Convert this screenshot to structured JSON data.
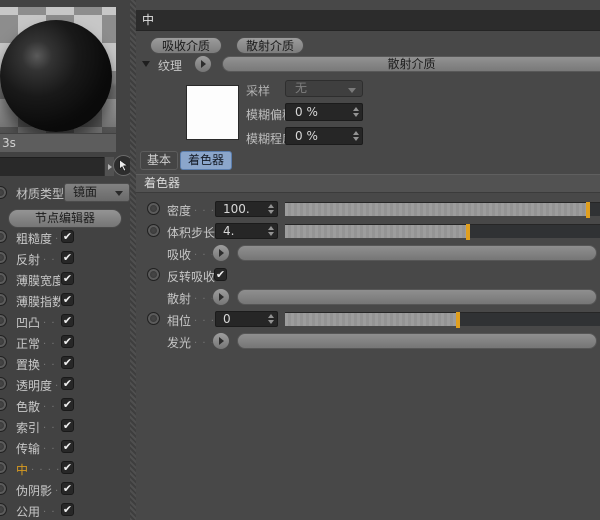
{
  "colors": {
    "accent_orange": "#d89b20",
    "tab_active_blue": "#8ba6cb",
    "slider_handle": "#e09f1e",
    "panel_bg": "#484848"
  },
  "left_panel": {
    "render_time": "3s",
    "name_field_value": "",
    "material_type": {
      "label": "材质类型",
      "value": "镜面"
    },
    "node_editor_button": "节点编辑器",
    "channels": [
      {
        "name": "roughness",
        "label": "粗糙度",
        "dots": ". .",
        "checked": true
      },
      {
        "name": "reflection",
        "label": "反射",
        "dots": ". . .",
        "checked": true
      },
      {
        "name": "film-width",
        "label": "薄膜宽度",
        "dots": "",
        "checked": true
      },
      {
        "name": "film-index",
        "label": "薄膜指数",
        "dots": "",
        "checked": true
      },
      {
        "name": "bump",
        "label": "凹凸",
        "dots": ". . .",
        "checked": true
      },
      {
        "name": "normal",
        "label": "正常",
        "dots": ". . .",
        "checked": true
      },
      {
        "name": "displacement",
        "label": "置换",
        "dots": ". . .",
        "checked": true
      },
      {
        "name": "transparency",
        "label": "透明度",
        "dots": ". .",
        "checked": true
      },
      {
        "name": "dispersion",
        "label": "色散",
        "dots": ". . .",
        "checked": true
      },
      {
        "name": "index",
        "label": "索引",
        "dots": ". . .",
        "checked": true
      },
      {
        "name": "transmission",
        "label": "传输",
        "dots": ". . .",
        "checked": true
      },
      {
        "name": "medium",
        "label": "中",
        "dots": ". . . . .",
        "checked": true,
        "highlight": true
      },
      {
        "name": "fake-shadow",
        "label": "伪阴影",
        "dots": ". .",
        "checked": true
      },
      {
        "name": "common",
        "label": "公用",
        "dots": ". . .",
        "checked": true
      }
    ]
  },
  "right_panel": {
    "header": "中",
    "medium_buttons": [
      "吸收介质",
      "散射介质"
    ],
    "texture": {
      "label": "纹理",
      "value": "散射介质"
    },
    "sampling": {
      "label": "采样",
      "value": "无",
      "disabled": true
    },
    "blur_offset": {
      "label": "模糊偏移",
      "value": "0 %"
    },
    "blur_strength": {
      "label": "模糊程度",
      "value": "0 %"
    },
    "tabs": [
      {
        "label": "基本",
        "active": false
      },
      {
        "label": "着色器",
        "active": true
      }
    ],
    "section": "着色器",
    "params": [
      {
        "name": "density",
        "label": "密度",
        "dots": ". . .",
        "control": "slider",
        "value": "100.",
        "fill": 0.962
      },
      {
        "name": "volume-step-size",
        "label": "体积步长",
        "dots": "",
        "control": "slider",
        "value": "4.",
        "fill": 0.581
      },
      {
        "name": "absorption",
        "label": "吸收",
        "dots": ". . .",
        "control": "texture"
      },
      {
        "name": "invert-absorption",
        "label": "反转吸收",
        "dots": "",
        "control": "checkbox",
        "checked": true
      },
      {
        "name": "scattering",
        "label": "散射",
        "dots": ". . .",
        "control": "texture"
      },
      {
        "name": "phase",
        "label": "相位",
        "dots": ". . .",
        "control": "slider",
        "value": "0",
        "fill": 0.549
      },
      {
        "name": "emission",
        "label": "发光",
        "dots": ". . .",
        "control": "texture"
      }
    ]
  }
}
